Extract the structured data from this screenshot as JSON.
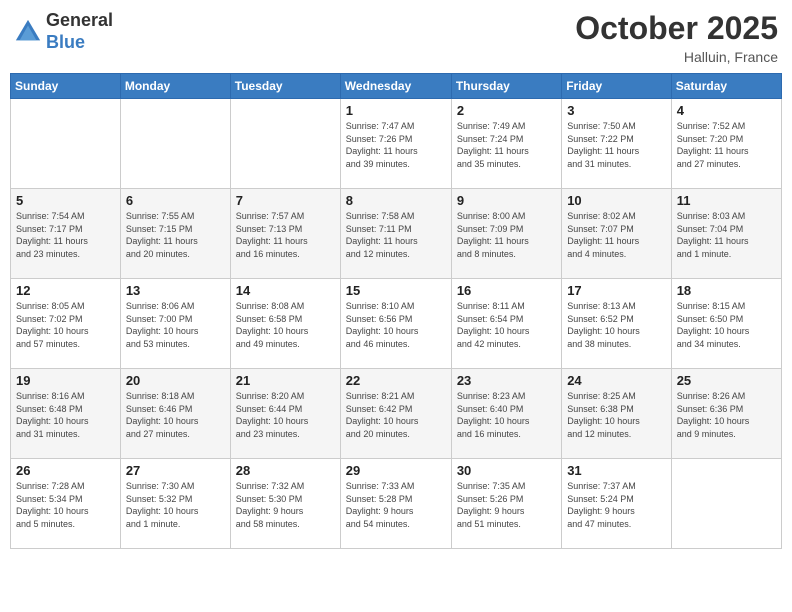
{
  "header": {
    "logo_general": "General",
    "logo_blue": "Blue",
    "month": "October 2025",
    "location": "Halluin, France"
  },
  "weekdays": [
    "Sunday",
    "Monday",
    "Tuesday",
    "Wednesday",
    "Thursday",
    "Friday",
    "Saturday"
  ],
  "weeks": [
    [
      {
        "day": "",
        "info": ""
      },
      {
        "day": "",
        "info": ""
      },
      {
        "day": "",
        "info": ""
      },
      {
        "day": "1",
        "info": "Sunrise: 7:47 AM\nSunset: 7:26 PM\nDaylight: 11 hours\nand 39 minutes."
      },
      {
        "day": "2",
        "info": "Sunrise: 7:49 AM\nSunset: 7:24 PM\nDaylight: 11 hours\nand 35 minutes."
      },
      {
        "day": "3",
        "info": "Sunrise: 7:50 AM\nSunset: 7:22 PM\nDaylight: 11 hours\nand 31 minutes."
      },
      {
        "day": "4",
        "info": "Sunrise: 7:52 AM\nSunset: 7:20 PM\nDaylight: 11 hours\nand 27 minutes."
      }
    ],
    [
      {
        "day": "5",
        "info": "Sunrise: 7:54 AM\nSunset: 7:17 PM\nDaylight: 11 hours\nand 23 minutes."
      },
      {
        "day": "6",
        "info": "Sunrise: 7:55 AM\nSunset: 7:15 PM\nDaylight: 11 hours\nand 20 minutes."
      },
      {
        "day": "7",
        "info": "Sunrise: 7:57 AM\nSunset: 7:13 PM\nDaylight: 11 hours\nand 16 minutes."
      },
      {
        "day": "8",
        "info": "Sunrise: 7:58 AM\nSunset: 7:11 PM\nDaylight: 11 hours\nand 12 minutes."
      },
      {
        "day": "9",
        "info": "Sunrise: 8:00 AM\nSunset: 7:09 PM\nDaylight: 11 hours\nand 8 minutes."
      },
      {
        "day": "10",
        "info": "Sunrise: 8:02 AM\nSunset: 7:07 PM\nDaylight: 11 hours\nand 4 minutes."
      },
      {
        "day": "11",
        "info": "Sunrise: 8:03 AM\nSunset: 7:04 PM\nDaylight: 11 hours\nand 1 minute."
      }
    ],
    [
      {
        "day": "12",
        "info": "Sunrise: 8:05 AM\nSunset: 7:02 PM\nDaylight: 10 hours\nand 57 minutes."
      },
      {
        "day": "13",
        "info": "Sunrise: 8:06 AM\nSunset: 7:00 PM\nDaylight: 10 hours\nand 53 minutes."
      },
      {
        "day": "14",
        "info": "Sunrise: 8:08 AM\nSunset: 6:58 PM\nDaylight: 10 hours\nand 49 minutes."
      },
      {
        "day": "15",
        "info": "Sunrise: 8:10 AM\nSunset: 6:56 PM\nDaylight: 10 hours\nand 46 minutes."
      },
      {
        "day": "16",
        "info": "Sunrise: 8:11 AM\nSunset: 6:54 PM\nDaylight: 10 hours\nand 42 minutes."
      },
      {
        "day": "17",
        "info": "Sunrise: 8:13 AM\nSunset: 6:52 PM\nDaylight: 10 hours\nand 38 minutes."
      },
      {
        "day": "18",
        "info": "Sunrise: 8:15 AM\nSunset: 6:50 PM\nDaylight: 10 hours\nand 34 minutes."
      }
    ],
    [
      {
        "day": "19",
        "info": "Sunrise: 8:16 AM\nSunset: 6:48 PM\nDaylight: 10 hours\nand 31 minutes."
      },
      {
        "day": "20",
        "info": "Sunrise: 8:18 AM\nSunset: 6:46 PM\nDaylight: 10 hours\nand 27 minutes."
      },
      {
        "day": "21",
        "info": "Sunrise: 8:20 AM\nSunset: 6:44 PM\nDaylight: 10 hours\nand 23 minutes."
      },
      {
        "day": "22",
        "info": "Sunrise: 8:21 AM\nSunset: 6:42 PM\nDaylight: 10 hours\nand 20 minutes."
      },
      {
        "day": "23",
        "info": "Sunrise: 8:23 AM\nSunset: 6:40 PM\nDaylight: 10 hours\nand 16 minutes."
      },
      {
        "day": "24",
        "info": "Sunrise: 8:25 AM\nSunset: 6:38 PM\nDaylight: 10 hours\nand 12 minutes."
      },
      {
        "day": "25",
        "info": "Sunrise: 8:26 AM\nSunset: 6:36 PM\nDaylight: 10 hours\nand 9 minutes."
      }
    ],
    [
      {
        "day": "26",
        "info": "Sunrise: 7:28 AM\nSunset: 5:34 PM\nDaylight: 10 hours\nand 5 minutes."
      },
      {
        "day": "27",
        "info": "Sunrise: 7:30 AM\nSunset: 5:32 PM\nDaylight: 10 hours\nand 1 minute."
      },
      {
        "day": "28",
        "info": "Sunrise: 7:32 AM\nSunset: 5:30 PM\nDaylight: 9 hours\nand 58 minutes."
      },
      {
        "day": "29",
        "info": "Sunrise: 7:33 AM\nSunset: 5:28 PM\nDaylight: 9 hours\nand 54 minutes."
      },
      {
        "day": "30",
        "info": "Sunrise: 7:35 AM\nSunset: 5:26 PM\nDaylight: 9 hours\nand 51 minutes."
      },
      {
        "day": "31",
        "info": "Sunrise: 7:37 AM\nSunset: 5:24 PM\nDaylight: 9 hours\nand 47 minutes."
      },
      {
        "day": "",
        "info": ""
      }
    ]
  ]
}
